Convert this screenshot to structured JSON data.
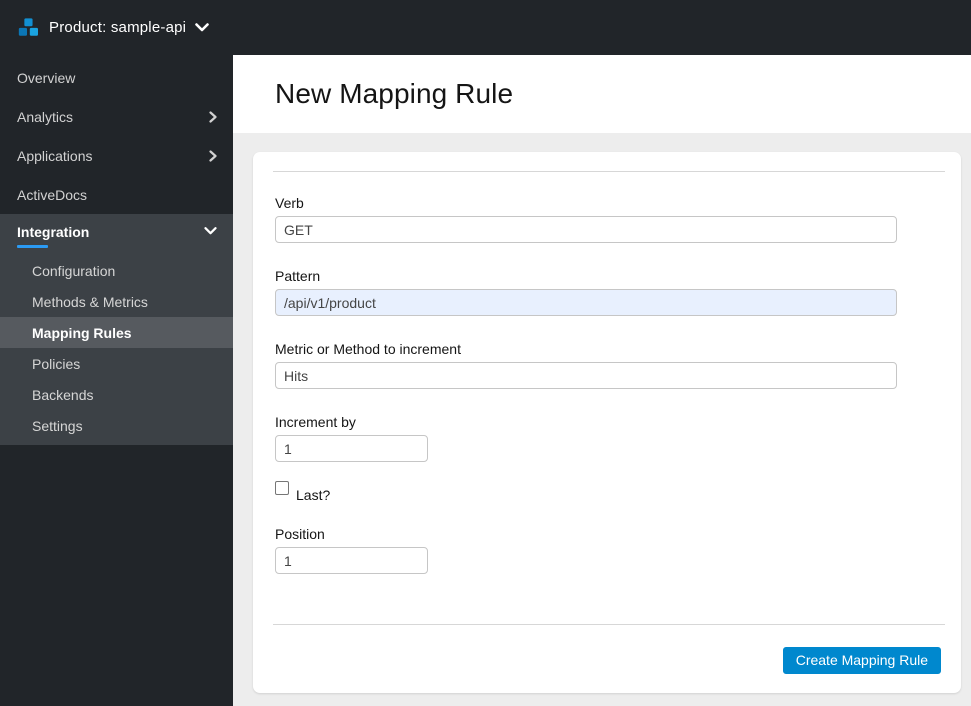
{
  "topbar": {
    "product_label": "Product: sample-api"
  },
  "sidebar": {
    "items": [
      {
        "label": "Overview",
        "has_submenu": false
      },
      {
        "label": "Analytics",
        "has_submenu": true
      },
      {
        "label": "Applications",
        "has_submenu": true
      },
      {
        "label": "ActiveDocs",
        "has_submenu": false
      }
    ],
    "integration": {
      "label": "Integration",
      "expanded": true,
      "subitems": [
        {
          "label": "Configuration",
          "active": false
        },
        {
          "label": "Methods & Metrics",
          "active": false
        },
        {
          "label": "Mapping Rules",
          "active": true
        },
        {
          "label": "Policies",
          "active": false
        },
        {
          "label": "Backends",
          "active": false
        },
        {
          "label": "Settings",
          "active": false
        }
      ]
    }
  },
  "main": {
    "title": "New Mapping Rule",
    "form": {
      "verb": {
        "label": "Verb",
        "value": "GET"
      },
      "pattern": {
        "label": "Pattern",
        "value": "/api/v1/product"
      },
      "metric": {
        "label": "Metric or Method to increment",
        "value": "Hits"
      },
      "increment": {
        "label": "Increment by",
        "value": "1"
      },
      "last": {
        "label": "Last?",
        "checked": false
      },
      "position": {
        "label": "Position",
        "value": "1"
      },
      "submit_label": "Create Mapping Rule"
    }
  },
  "colors": {
    "topbar_bg": "#212529",
    "sidebar_bg": "#212529",
    "section_bg": "#3c4146",
    "selected_bg": "#565a5f",
    "accent_underline": "#2b9af3",
    "primary_button": "#0088ce",
    "autofill_bg": "#e8f0fe",
    "page_bg": "#ededed"
  }
}
